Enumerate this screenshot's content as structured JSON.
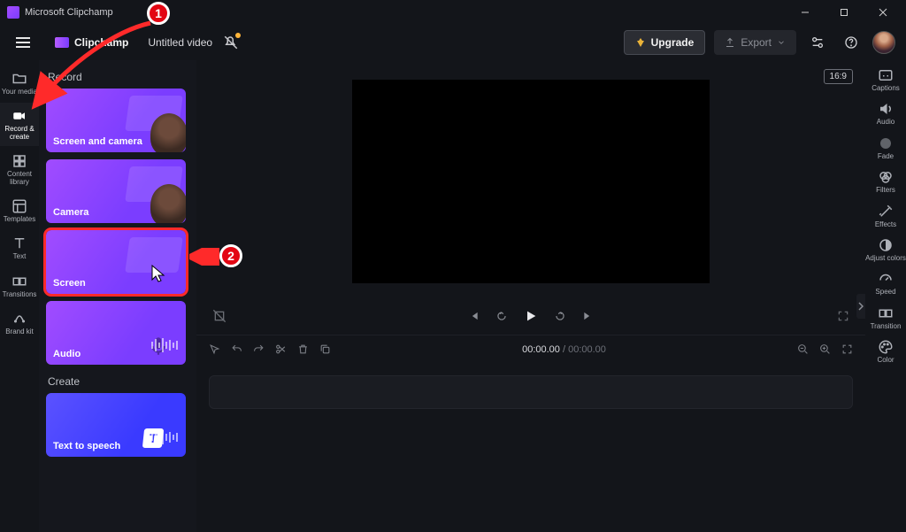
{
  "titlebar": {
    "app_name": "Microsoft Clipchamp"
  },
  "appbar": {
    "brand": "Clipchamp",
    "project": "Untitled video",
    "upgrade": "Upgrade",
    "export": "Export"
  },
  "left_rail": {
    "items": [
      {
        "label": "Your media"
      },
      {
        "label": "Record & create"
      },
      {
        "label": "Content library"
      },
      {
        "label": "Templates"
      },
      {
        "label": "Text"
      },
      {
        "label": "Transitions"
      },
      {
        "label": "Brand kit"
      }
    ]
  },
  "panel": {
    "section_record": "Record",
    "section_create": "Create",
    "cards": {
      "screen_camera": "Screen and camera",
      "camera": "Camera",
      "screen": "Screen",
      "audio": "Audio",
      "tts": "Text to speech"
    }
  },
  "preview": {
    "aspect": "16:9",
    "timecode_current": "00:00.00",
    "timecode_duration": "00:00.00"
  },
  "right_rail": {
    "items": [
      {
        "label": "Captions"
      },
      {
        "label": "Audio"
      },
      {
        "label": "Fade"
      },
      {
        "label": "Filters"
      },
      {
        "label": "Effects"
      },
      {
        "label": "Adjust colors"
      },
      {
        "label": "Speed"
      },
      {
        "label": "Transition"
      },
      {
        "label": "Color"
      }
    ]
  },
  "annotations": {
    "badge1": "1",
    "badge2": "2"
  }
}
